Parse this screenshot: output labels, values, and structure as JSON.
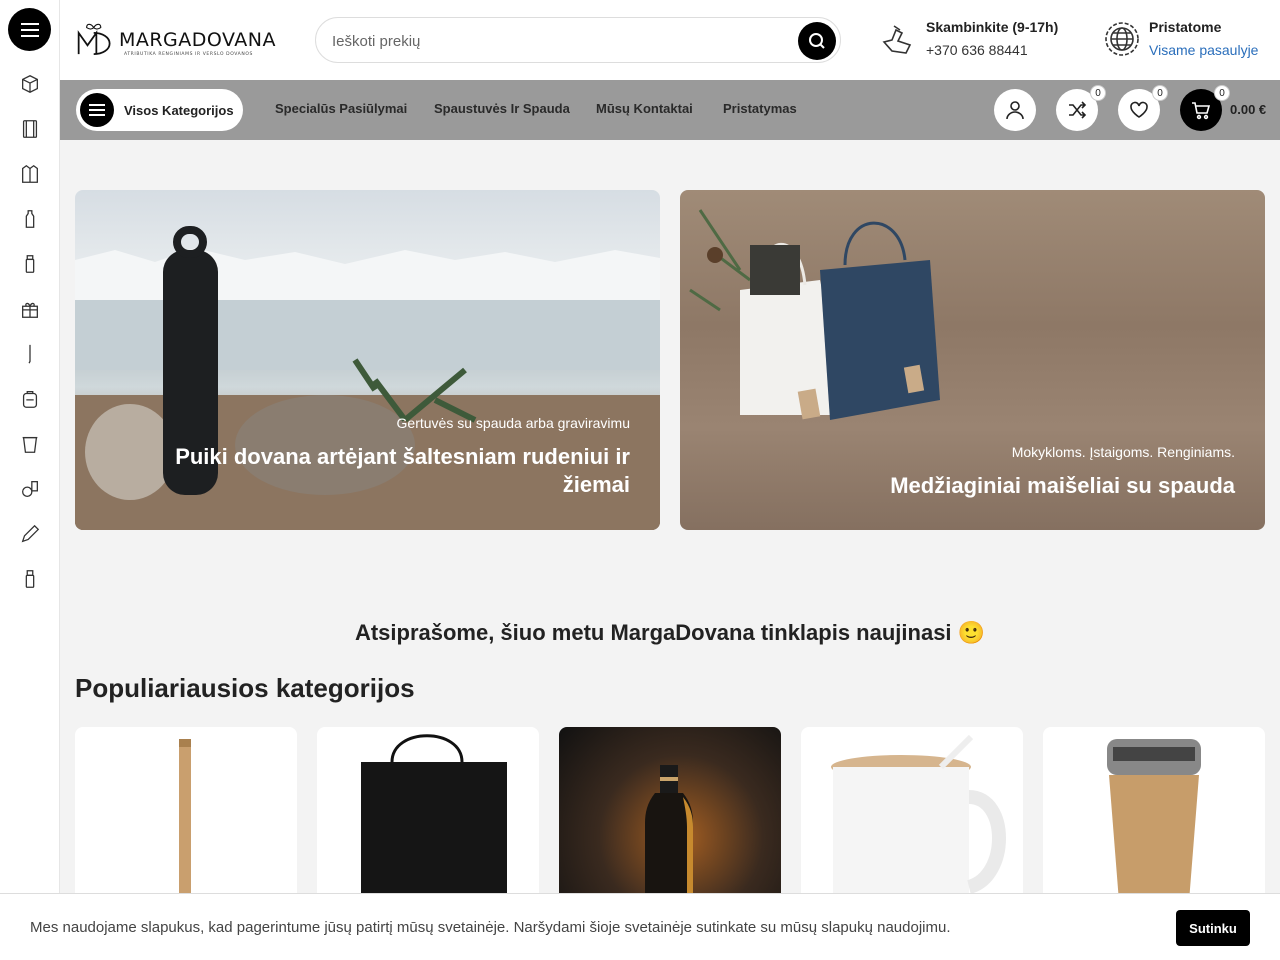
{
  "header": {
    "logo_text": "MARGADOVANA",
    "logo_subtitle": "ATRIBUTIKA RENGINIAMS IR VERSLO DOVANOS",
    "search_placeholder": "Ieškoti prekių",
    "phone": {
      "title": "Skambinkite (9-17h)",
      "number": "+370 636 88441"
    },
    "shipping": {
      "title": "Pristatome",
      "link": "Visame pasaulyje"
    }
  },
  "navbar": {
    "categories_label": "Visos Kategorijos",
    "links": [
      "Specialūs Pasiūlymai",
      "Spaustuvės Ir Spauda",
      "Mūsų Kontaktai",
      "Pristatymas"
    ],
    "compare_count": "0",
    "wishlist_count": "0",
    "cart_count": "0",
    "cart_total": "0.00 €"
  },
  "sidebar": {
    "icons": [
      "tech-gadgets-icon",
      "notebook-icon",
      "jacket-icon",
      "bottle-icon",
      "thermos-icon",
      "gift-set-icon",
      "pen-icon",
      "backpack-icon",
      "cup-icon",
      "tools-icon",
      "pencil-icon",
      "usb-icon"
    ]
  },
  "banners": [
    {
      "subtitle": "Gertuvės su spauda arba graviravimu",
      "title": "Puiki dovana artėjant šaltesniam rudeniui ir žiemai"
    },
    {
      "subtitle": "Mokykloms. Įstaigoms. Renginiams.",
      "title": "Medžiaginiai maišeliai su spauda"
    }
  ],
  "notice": "Atsiprašome, šiuo metu MargaDovana tinklapis naujinasi 🙂",
  "popular": {
    "title": "Populiariausios kategorijos",
    "cards": [
      "wooden-pen",
      "black-tote-bag",
      "gold-bottle",
      "ceramic-mug",
      "bamboo-tumbler"
    ]
  },
  "cookie": {
    "text": "Mes naudojame slapukus, kad pagerintume jūsų patirtį mūsų svetainėje. Naršydami šioje svetainėje sutinkate su mūsų slapukų naudojimu.",
    "accept": "Sutinku"
  },
  "colors": {
    "accent": "#000000",
    "navbar": "#9a9a9a",
    "link": "#2a6ebb"
  }
}
